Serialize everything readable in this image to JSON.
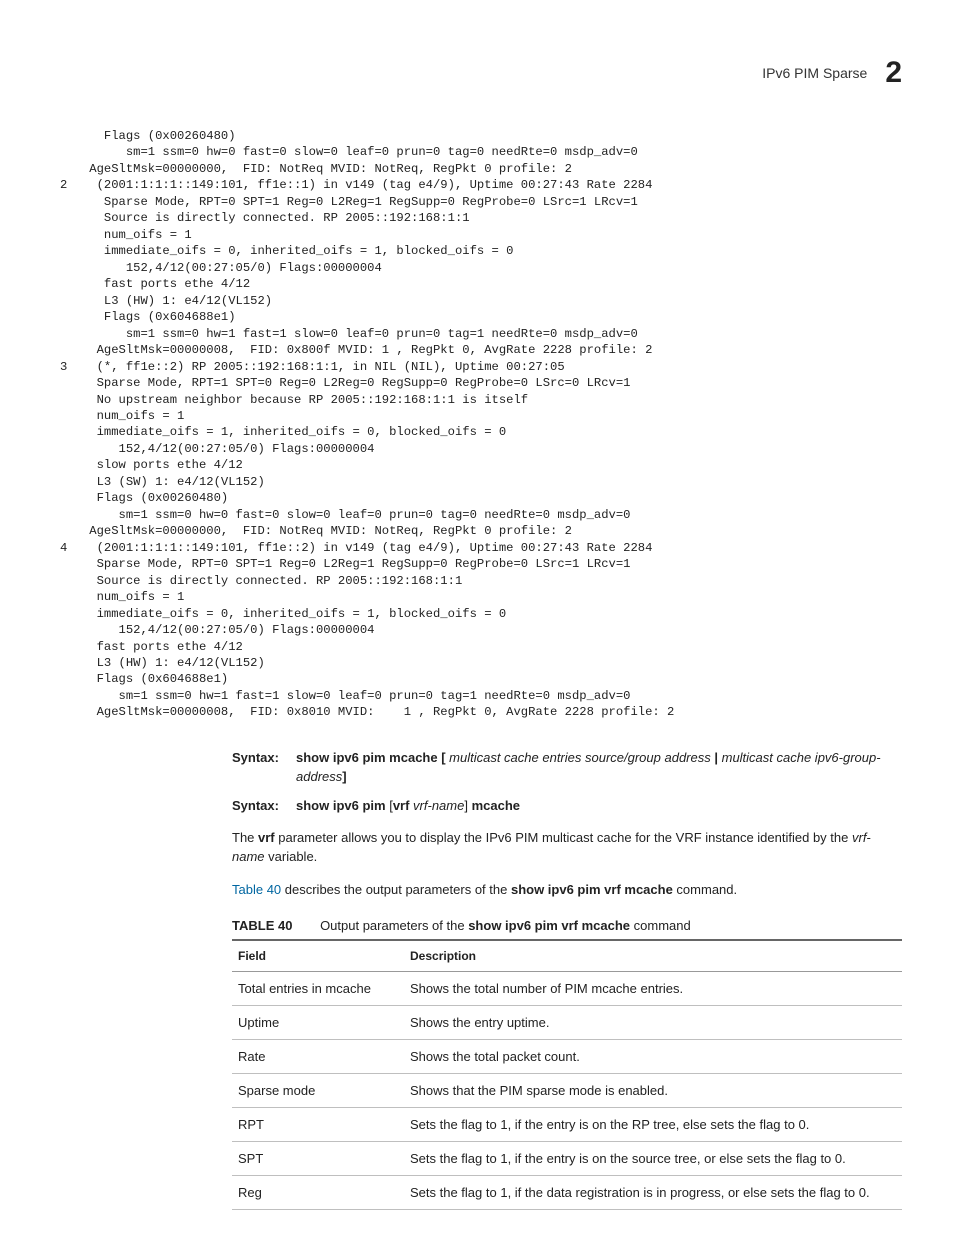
{
  "header": {
    "title": "IPv6 PIM Sparse",
    "chapter_number": "2"
  },
  "code": "      Flags (0x00260480)\n         sm=1 ssm=0 hw=0 fast=0 slow=0 leaf=0 prun=0 tag=0 needRte=0 msdp_adv=0\n    AgeSltMsk=00000000,  FID: NotReq MVID: NotReq, RegPkt 0 profile: 2\n2    (2001:1:1:1::149:101, ff1e::1) in v149 (tag e4/9), Uptime 00:27:43 Rate 2284\n      Sparse Mode, RPT=0 SPT=1 Reg=0 L2Reg=1 RegSupp=0 RegProbe=0 LSrc=1 LRcv=1\n      Source is directly connected. RP 2005::192:168:1:1\n      num_oifs = 1\n      immediate_oifs = 0, inherited_oifs = 1, blocked_oifs = 0      \n         152,4/12(00:27:05/0) Flags:00000004\n      fast ports ethe 4/12 \n      L3 (HW) 1: e4/12(VL152)\n      Flags (0x604688e1)\n         sm=1 ssm=0 hw=1 fast=1 slow=0 leaf=0 prun=0 tag=1 needRte=0 msdp_adv=0\n     AgeSltMsk=00000008,  FID: 0x800f MVID: 1 , RegPkt 0, AvgRate 2228 profile: 2\n3    (*, ff1e::2) RP 2005::192:168:1:1, in NIL (NIL), Uptime 00:27:05 \n     Sparse Mode, RPT=1 SPT=0 Reg=0 L2Reg=0 RegSupp=0 RegProbe=0 LSrc=0 LRcv=1\n     No upstream neighbor because RP 2005::192:168:1:1 is itself\n     num_oifs = 1\n     immediate_oifs = 1, inherited_oifs = 0, blocked_oifs = 0      \n        152,4/12(00:27:05/0) Flags:00000004\n     slow ports ethe 4/12 \n     L3 (SW) 1: e4/12(VL152)\n     Flags (0x00260480)\n        sm=1 ssm=0 hw=0 fast=0 slow=0 leaf=0 prun=0 tag=0 needRte=0 msdp_adv=0\n    AgeSltMsk=00000000,  FID: NotReq MVID: NotReq, RegPkt 0 profile: 2\n4    (2001:1:1:1::149:101, ff1e::2) in v149 (tag e4/9), Uptime 00:27:43 Rate 2284\n     Sparse Mode, RPT=0 SPT=1 Reg=0 L2Reg=1 RegSupp=0 RegProbe=0 LSrc=1 LRcv=1\n     Source is directly connected. RP 2005::192:168:1:1\n     num_oifs = 1\n     immediate_oifs = 0, inherited_oifs = 1, blocked_oifs = 0      \n        152,4/12(00:27:05/0) Flags:00000004\n     fast ports ethe 4/12 \n     L3 (HW) 1: e4/12(VL152)\n     Flags (0x604688e1)\n        sm=1 ssm=0 hw=1 fast=1 slow=0 leaf=0 prun=0 tag=1 needRte=0 msdp_adv=0\n     AgeSltMsk=00000008,  FID: 0x8010 MVID:    1 , RegPkt 0, AvgRate 2228 profile: 2",
  "syntax1": {
    "label": "Syntax:",
    "cmd_pre": "show ipv6 pim mcache [ ",
    "arg1": "multicast cache entries source/group address",
    "sep": " | ",
    "arg2": "multicast cache ipv6-group-address",
    "cmd_post": "]"
  },
  "syntax2": {
    "label": "Syntax:",
    "cmd_pre": "show ipv6 pim ",
    "bracket_open": "[",
    "vrf_kw": "vrf ",
    "vrf_arg": "vrf-name",
    "bracket_close": "] ",
    "cmd_post": "mcache"
  },
  "vrf_para": {
    "the": "The ",
    "vrf_bold": "vrf",
    "rest1": " parameter allows you to display the IPv6 PIM multicast cache for the VRF instance identified by the ",
    "vrf_name": "vrf-name",
    "rest2": " variable."
  },
  "table_sentence": {
    "ref": "Table 40",
    "rest1": " describes the output parameters of the ",
    "cmd": "show ipv6 pim vrf mcache",
    "rest2": " command."
  },
  "table_caption": {
    "label": "TABLE 40",
    "pre": "Output parameters of the ",
    "cmd": "show ipv6 pim vrf mcache",
    "post": " command"
  },
  "table": {
    "headers": {
      "field": "Field",
      "desc": "Description"
    },
    "rows": [
      {
        "field": "Total entries in mcache",
        "desc": "Shows the total number of PIM mcache entries."
      },
      {
        "field": "Uptime",
        "desc": "Shows the entry uptime."
      },
      {
        "field": "Rate",
        "desc": "Shows the total packet count."
      },
      {
        "field": "Sparse mode",
        "desc": "Shows that the PIM sparse mode is enabled."
      },
      {
        "field": "RPT",
        "desc": "Sets the flag to 1, if the entry is on the RP tree, else sets the flag to 0."
      },
      {
        "field": "SPT",
        "desc": "Sets the flag to 1, if the entry is on the source tree, or else sets the flag to 0."
      },
      {
        "field": "Reg",
        "desc": "Sets the flag to 1, if the data registration is in progress, or else sets the flag to 0."
      }
    ]
  }
}
